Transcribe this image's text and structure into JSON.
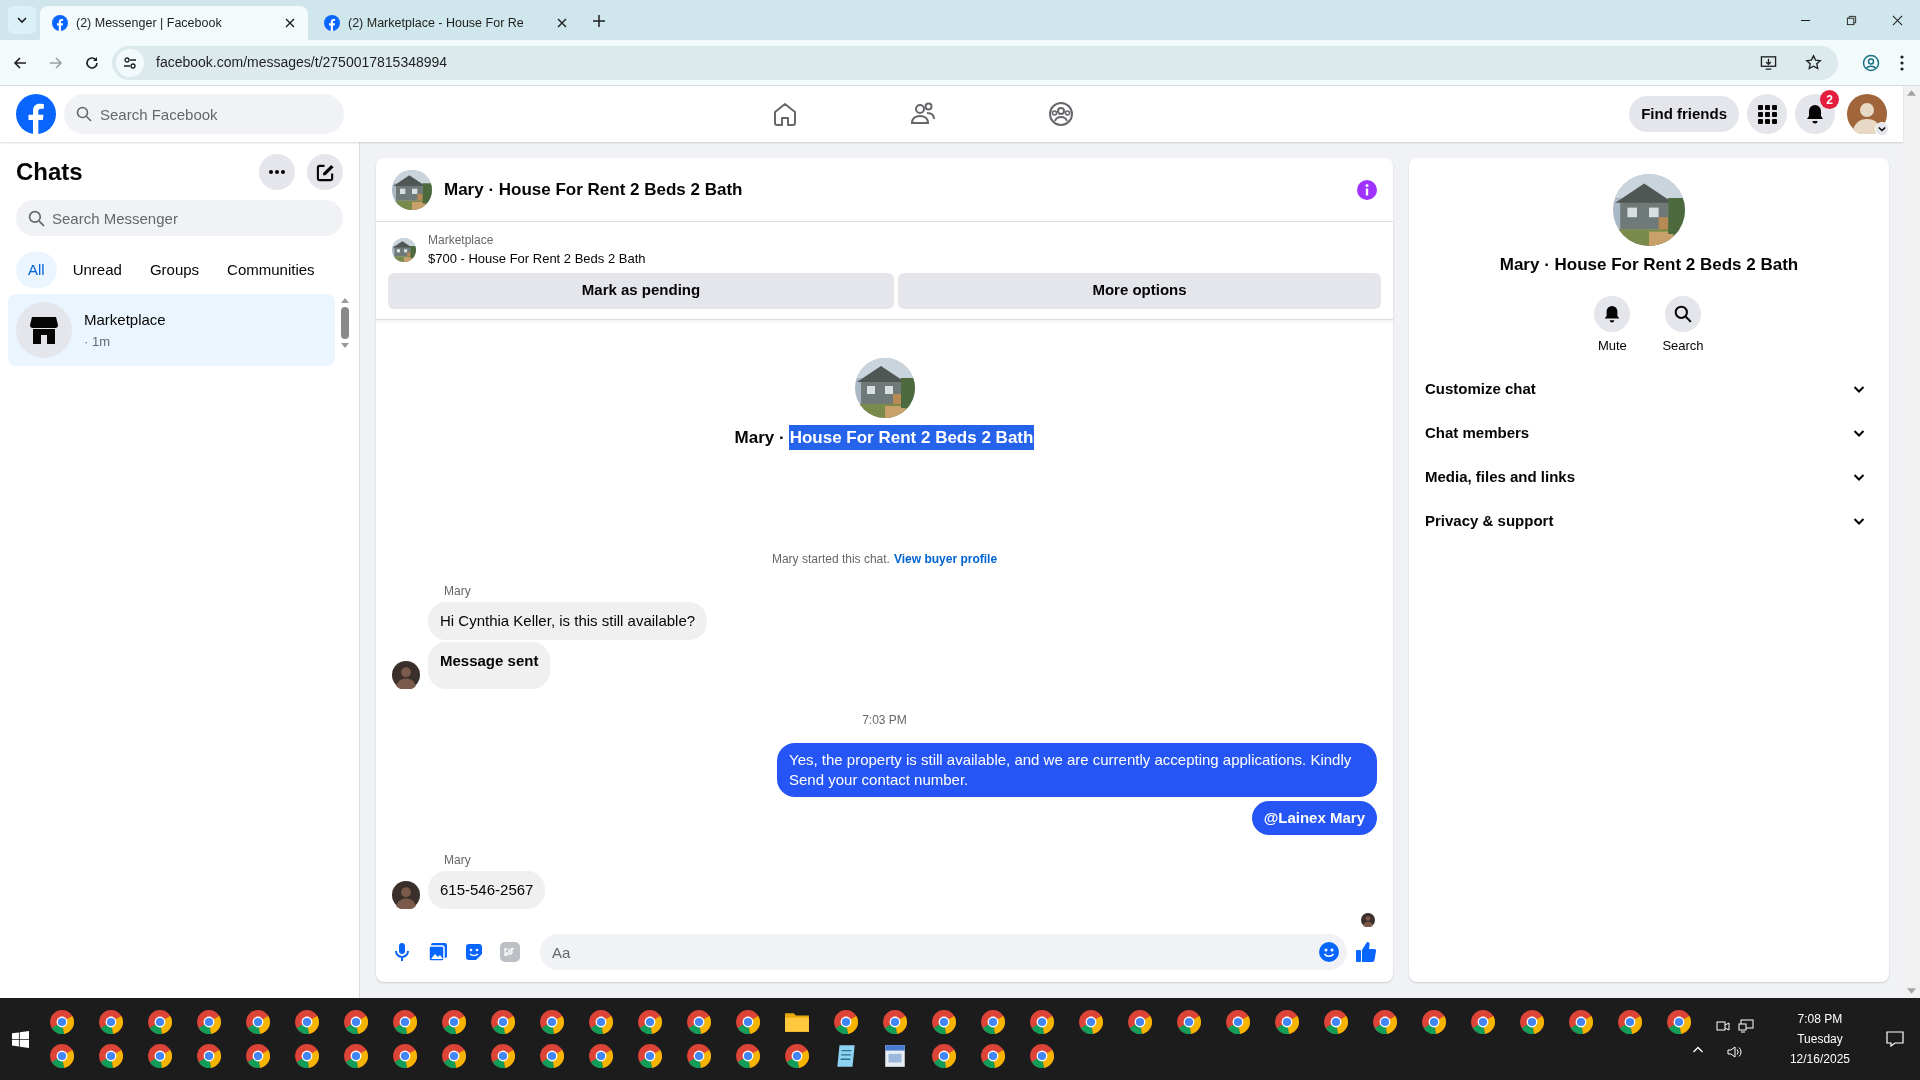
{
  "browser": {
    "tabs": [
      {
        "title": "(2) Messenger | Facebook",
        "selected": true
      },
      {
        "title": "(2) Marketplace - House For Re",
        "selected": false
      }
    ],
    "address": "facebook.com/messages/t/2750017815348994"
  },
  "header": {
    "search_placeholder": "Search Facebook",
    "find_friends": "Find friends",
    "notification_count": "2"
  },
  "sidebar": {
    "title": "Chats",
    "search_placeholder": "Search Messenger",
    "filters": [
      {
        "label": "All",
        "selected": true
      },
      {
        "label": "Unread",
        "selected": false
      },
      {
        "label": "Groups",
        "selected": false
      },
      {
        "label": "Communities",
        "selected": false
      }
    ],
    "chats": [
      {
        "name": "Marketplace",
        "time": "· 1m",
        "selected": true
      }
    ]
  },
  "conversation": {
    "title": "Mary · House For Rent 2 Beds 2 Bath",
    "listing": {
      "source": "Marketplace",
      "title": "$700 - House For Rent 2 Beds 2 Bath",
      "buttons": [
        "Mark as pending",
        "More options"
      ]
    },
    "intro": {
      "name": "Mary ·",
      "title": "House For Rent 2 Beds 2 Bath",
      "title_highlighted": true
    },
    "started_note": "Mary started this chat.",
    "profile_link": "View buyer profile",
    "items": [
      {
        "kind": "incoming",
        "sender": "Mary",
        "messages": [
          {
            "text": "Hi Cynthia Keller, is this still available?",
            "bold": false
          },
          {
            "text": "Message sent",
            "bold": true
          }
        ]
      },
      {
        "kind": "time",
        "text": "7:03 PM"
      },
      {
        "kind": "outgoing",
        "messages": [
          {
            "text": "Yes, the property is still available, and we are currently accepting applications. Kindly Send your contact number.",
            "bold": false
          },
          {
            "text": "@Lainex Mary",
            "bold": true
          }
        ]
      },
      {
        "kind": "incoming",
        "sender": "Mary",
        "messages": [
          {
            "text": "615-546-2567",
            "bold": false
          }
        ]
      }
    ],
    "composer_placeholder": "Aa"
  },
  "details": {
    "name": "Mary · House For Rent 2 Beds 2 Bath",
    "actions": [
      {
        "kind": "mute",
        "label": "Mute"
      },
      {
        "kind": "search",
        "label": "Search"
      }
    ],
    "sections": [
      "Customize chat",
      "Chat members",
      "Media, files and links",
      "Privacy & support"
    ]
  },
  "taskbar": {
    "top_row": [
      {
        "kind": "browser"
      },
      {
        "kind": "browser"
      },
      {
        "kind": "browser"
      },
      {
        "kind": "browser"
      },
      {
        "kind": "browser"
      },
      {
        "kind": "browser"
      },
      {
        "kind": "browser"
      },
      {
        "kind": "browser"
      },
      {
        "kind": "browser"
      },
      {
        "kind": "browser"
      },
      {
        "kind": "browser"
      },
      {
        "kind": "browser"
      },
      {
        "kind": "browser"
      },
      {
        "kind": "browser"
      },
      {
        "kind": "browser"
      },
      {
        "kind": "folder"
      },
      {
        "kind": "browser"
      },
      {
        "kind": "browser"
      },
      {
        "kind": "browser"
      },
      {
        "kind": "browser"
      },
      {
        "kind": "browser"
      },
      {
        "kind": "browser"
      },
      {
        "kind": "browser"
      },
      {
        "kind": "browser"
      },
      {
        "kind": "browser"
      },
      {
        "kind": "browser"
      },
      {
        "kind": "browser"
      },
      {
        "kind": "browser"
      },
      {
        "kind": "browser"
      },
      {
        "kind": "browser"
      },
      {
        "kind": "browser"
      },
      {
        "kind": "browser"
      },
      {
        "kind": "browser"
      },
      {
        "kind": "browser"
      }
    ],
    "bottom_row": [
      {
        "kind": "browser"
      },
      {
        "kind": "browser"
      },
      {
        "kind": "browser"
      },
      {
        "kind": "browser"
      },
      {
        "kind": "browser"
      },
      {
        "kind": "browser"
      },
      {
        "kind": "browser"
      },
      {
        "kind": "browser"
      },
      {
        "kind": "browser"
      },
      {
        "kind": "browser"
      },
      {
        "kind": "browser"
      },
      {
        "kind": "browser"
      },
      {
        "kind": "browser"
      },
      {
        "kind": "browser"
      },
      {
        "kind": "browser"
      },
      {
        "kind": "browser"
      },
      {
        "kind": "notepad"
      },
      {
        "kind": "document"
      },
      {
        "kind": "browser"
      },
      {
        "kind": "browser"
      },
      {
        "kind": "browser"
      }
    ],
    "time": "7:08 PM",
    "day": "Tuesday",
    "date": "12/16/2025"
  }
}
